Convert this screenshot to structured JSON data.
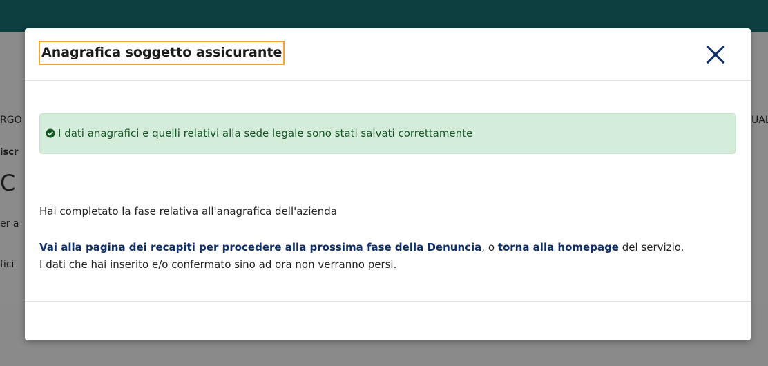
{
  "background": {
    "left_fragments": [
      "RGO",
      "iscr",
      "C",
      "er a",
      "fici"
    ],
    "right_fragment": "UAL"
  },
  "modal": {
    "title": "Anagrafica soggetto assicurante",
    "close_icon": "close-icon",
    "alert": {
      "icon": "check-circle-icon",
      "text": "I dati anagrafici e quelli relativi alla sede legale sono stati salvati correttamente"
    },
    "completed_text": "Hai completato la fase relativa all'anagrafica dell'azienda",
    "link_recapiti": "Vai alla pagina dei recapiti per procedere alla prossima fase della Denuncia",
    "separator": ", o ",
    "link_homepage": "torna alla homepage",
    "after_links": " del servizio.",
    "note": "I dati che hai inserito e/o confermato sino ad ora non verranno persi."
  },
  "colors": {
    "topbar": "#0d3f40",
    "alert_bg": "#d4eddb",
    "alert_text": "#155724",
    "link": "#0f2e6a",
    "focus_outline": "#f4a338"
  }
}
